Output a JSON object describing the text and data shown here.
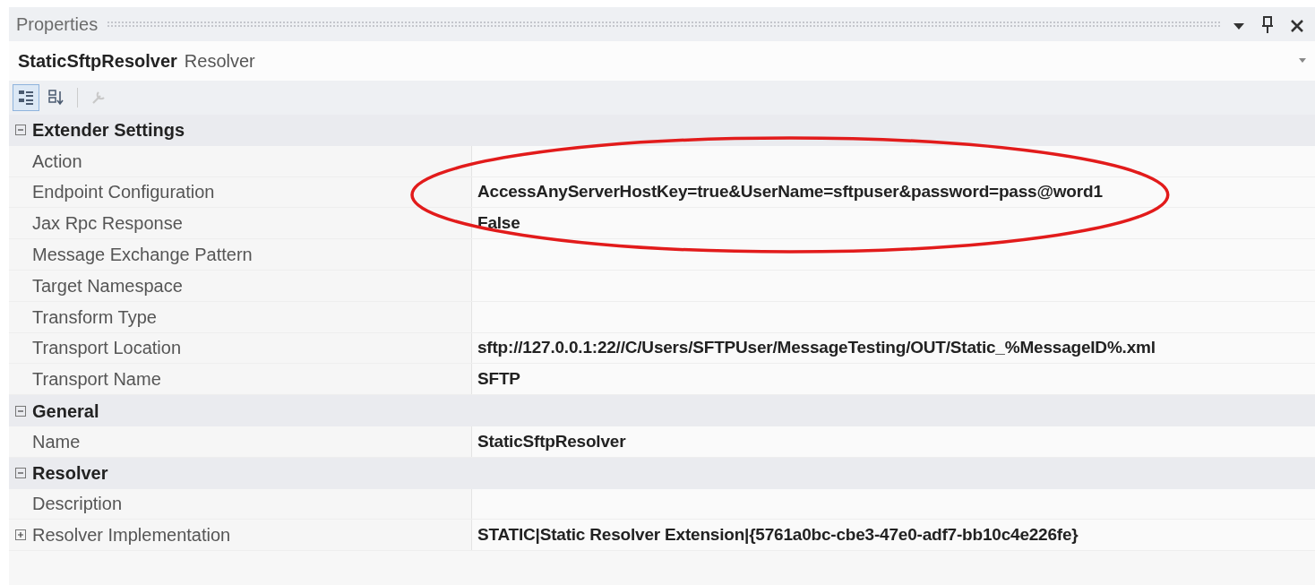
{
  "window": {
    "title": "Properties"
  },
  "object_selector": {
    "name": "StaticSftpResolver",
    "type": "Resolver"
  },
  "toolbar": [
    {
      "kind": "categorized",
      "selected": true
    },
    {
      "kind": "alphabetical",
      "selected": false
    },
    {
      "kind": "separator"
    },
    {
      "kind": "property-pages",
      "disabled": true
    }
  ],
  "categories": [
    {
      "name": "Extender Settings",
      "expanded": true,
      "properties": [
        {
          "name": "Action"
        },
        {
          "name": "Endpoint Configuration",
          "value": "AccessAnyServerHostKey=true&UserName=sftpuser&password=pass@word1",
          "highlighted": true
        },
        {
          "name": "Jax Rpc Response",
          "value": "False"
        },
        {
          "name": "Message Exchange Pattern"
        },
        {
          "name": "Target Namespace"
        },
        {
          "name": "Transform Type"
        },
        {
          "name": "Transport Location",
          "value": "sftp://127.0.0.1:22//C/Users/SFTPUser/MessageTesting/OUT/Static_%MessageID%.xml"
        },
        {
          "name": "Transport Name",
          "value": "SFTP"
        }
      ]
    },
    {
      "name": "General",
      "expanded": true,
      "properties": [
        {
          "name": "Name",
          "value": "StaticSftpResolver"
        }
      ]
    },
    {
      "name": "Resolver",
      "expanded": true,
      "properties": [
        {
          "name": "Description"
        },
        {
          "name": "Resolver Implementation",
          "value": "STATIC|Static Resolver Extension|{5761a0bc-cbe3-47e0-adf7-bb10c4e226fe}",
          "expanded": false
        }
      ]
    }
  ]
}
